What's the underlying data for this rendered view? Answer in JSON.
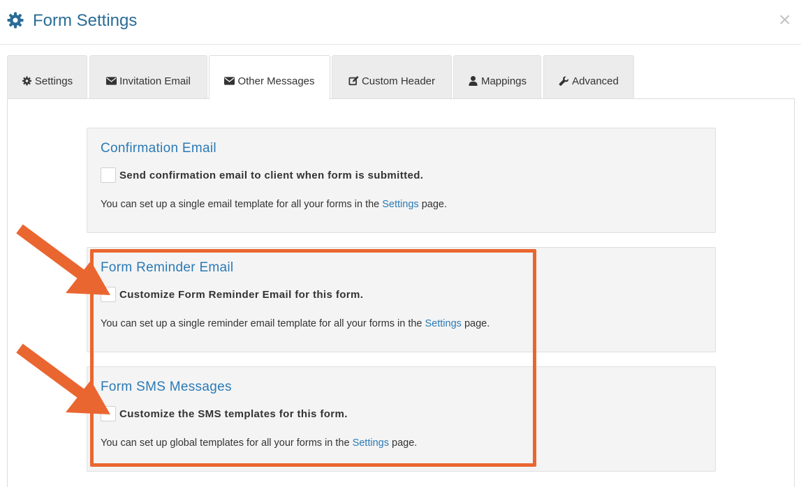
{
  "dialog": {
    "title": "Form Settings",
    "close_glyph": "×",
    "icons": {
      "title": "gear-icon",
      "close": "close-icon"
    }
  },
  "tabs": [
    {
      "label": "Settings",
      "icon": "gear-icon",
      "active": false
    },
    {
      "label": "Invitation Email",
      "icon": "envelope-icon",
      "active": false
    },
    {
      "label": "Other Messages",
      "icon": "envelope-icon",
      "active": true
    },
    {
      "label": "Custom Header",
      "icon": "edit-icon",
      "active": false
    },
    {
      "label": "Mappings",
      "icon": "user-icon",
      "active": false
    },
    {
      "label": "Advanced",
      "icon": "wrench-icon",
      "active": false
    }
  ],
  "sections": [
    {
      "title": "Confirmation Email",
      "checkbox_label": "Send confirmation email to client when form is submitted.",
      "checked": false,
      "help_prefix": "You can set up a single email template for all your forms in the",
      "help_link": "Settings",
      "help_suffix": "page."
    },
    {
      "title": "Form Reminder Email",
      "checkbox_label": "Customize Form Reminder Email for this form.",
      "checked": false,
      "help_prefix": "You can set up a single reminder email template for all your forms in the",
      "help_link": "Settings",
      "help_suffix": "page."
    },
    {
      "title": "Form SMS Messages",
      "checkbox_label": "Customize the SMS templates for this form.",
      "checked": false,
      "help_prefix": "You can set up global templates for all your forms in the",
      "help_link": "Settings",
      "help_suffix": "page."
    }
  ],
  "colors": {
    "title": "#2a6c96",
    "link": "#2a7ab5",
    "annotation": "#ea6630",
    "section_bg": "#f4f4f4"
  }
}
